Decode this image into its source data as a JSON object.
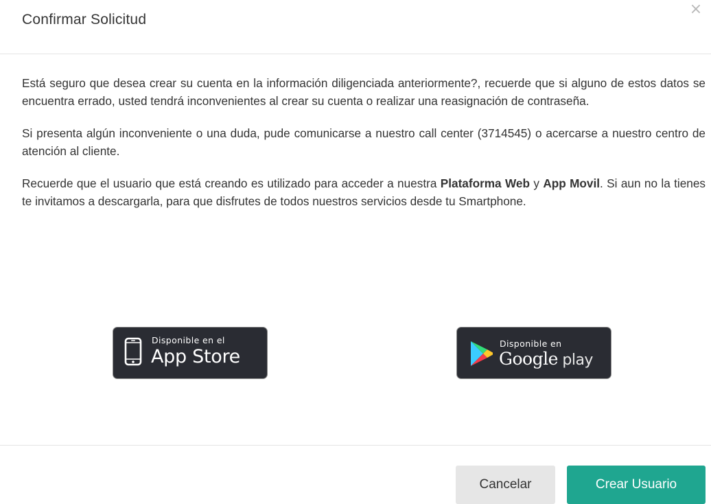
{
  "dialog": {
    "title": "Confirmar Solicitud",
    "close_label": "×",
    "body": {
      "paragraph1": "Está seguro que desea crear su cuenta en la información diligenciada anteriormente?, recuerde que si alguno de estos datos se encuentra errado, usted tendrá inconvenientes al crear su cuenta o realizar una reasignación de contraseña.",
      "paragraph2": "Si presenta algún inconveniente o una duda, pude comunicarse a nuestro call center (3714545) o acercarse a nuestro centro de atención al cliente.",
      "paragraph3": {
        "text_a": "Recuerde que el usuario que está creando es utilizado para acceder a nuestra ",
        "bold_a": "Plataforma Web",
        "text_b": " y ",
        "bold_b": "App Movil",
        "text_c": ". Si aun no la tienes te invitamos a descargarla, para que disfrutes de todos nuestros servicios desde tu Smartphone."
      }
    },
    "badges": {
      "app_store": {
        "small": "Disponible en el",
        "big": "App Store",
        "icon": "phone-icon"
      },
      "google_play": {
        "small": "Disponible en",
        "big_a": "Google",
        "big_b": " play",
        "icon": "google-play-icon"
      }
    },
    "footer": {
      "cancel_label": "Cancelar",
      "create_label": "Crear Usuario"
    },
    "colors": {
      "primary": "#1fa690",
      "cancel_bg": "#e6e6e6",
      "badge_bg": "#2a2c33"
    }
  }
}
